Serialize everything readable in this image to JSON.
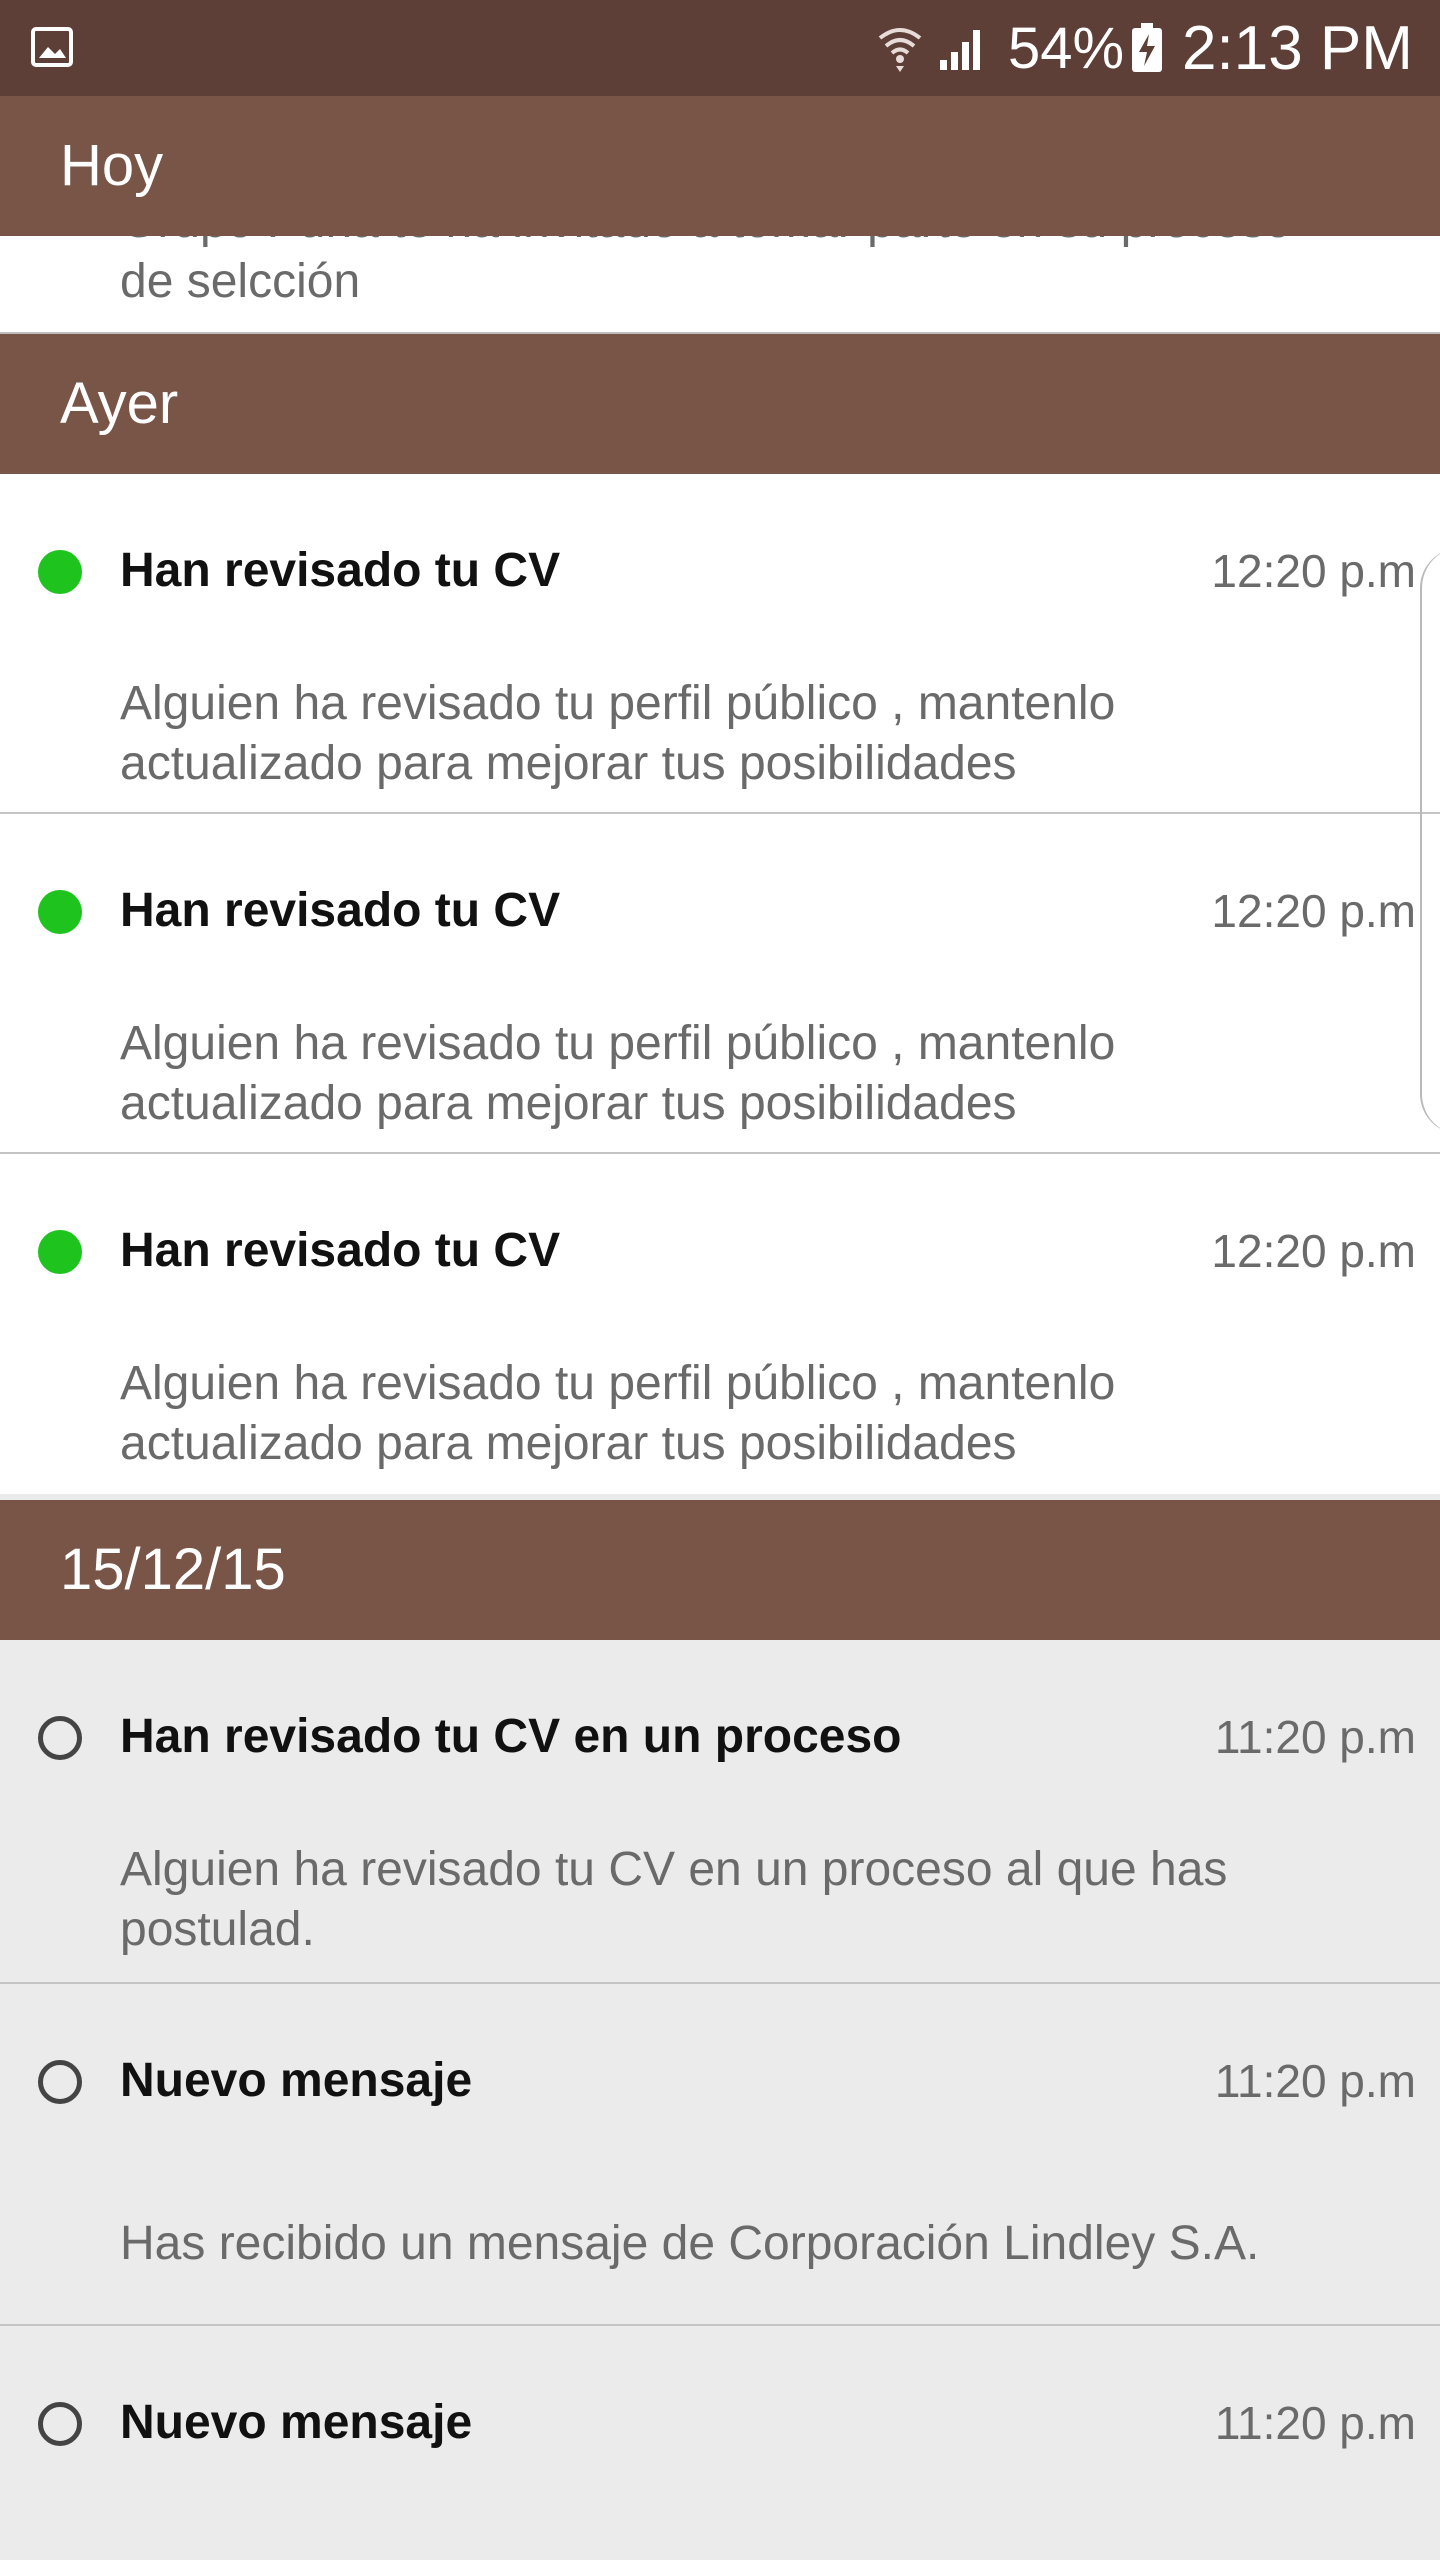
{
  "status_bar": {
    "battery": "54%",
    "time": "2:13 PM",
    "icons": [
      "gallery-icon",
      "wifi-icon",
      "signal-icon",
      "battery-charging-icon"
    ]
  },
  "colors": {
    "status_bar": "#5d3f37",
    "section_header": "#795548",
    "unread_dot": "#1ec31e",
    "unread_bg": "#ffffff",
    "read_bg": "#ebebeb"
  },
  "sections": [
    {
      "label": "Hoy",
      "items": [
        {
          "body": "Grupo Puna te ha invitado a tomar parte en su proceso de selcción"
        }
      ]
    },
    {
      "label": "Ayer",
      "items": [
        {
          "title": "Han revisado tu CV",
          "time": "12:20 p.m",
          "body": "Alguien ha revisado tu perfil público , mantenlo actualizado para mejorar tus posibilidades",
          "unread": true
        },
        {
          "title": "Han revisado tu CV",
          "time": "12:20 p.m",
          "body": "Alguien ha revisado tu perfil público , mantenlo actualizado para mejorar tus posibilidades",
          "unread": true
        },
        {
          "title": "Han revisado tu CV",
          "time": "12:20 p.m",
          "body": "Alguien ha revisado tu perfil público , mantenlo actualizado para mejorar tus posibilidades",
          "unread": true
        }
      ]
    },
    {
      "label": "15/12/15",
      "items": [
        {
          "title": "Han revisado tu CV en un proceso",
          "time": "11:20 p.m",
          "body": "Alguien ha revisado tu CV en un proceso al que has postulad.",
          "unread": false
        },
        {
          "title": "Nuevo mensaje",
          "time": "11:20 p.m",
          "body": "Has recibido un mensaje de Corporación Lindley S.A.",
          "unread": false
        },
        {
          "title": "Nuevo mensaje",
          "time": "11:20 p.m",
          "body": "",
          "unread": false
        }
      ]
    }
  ]
}
